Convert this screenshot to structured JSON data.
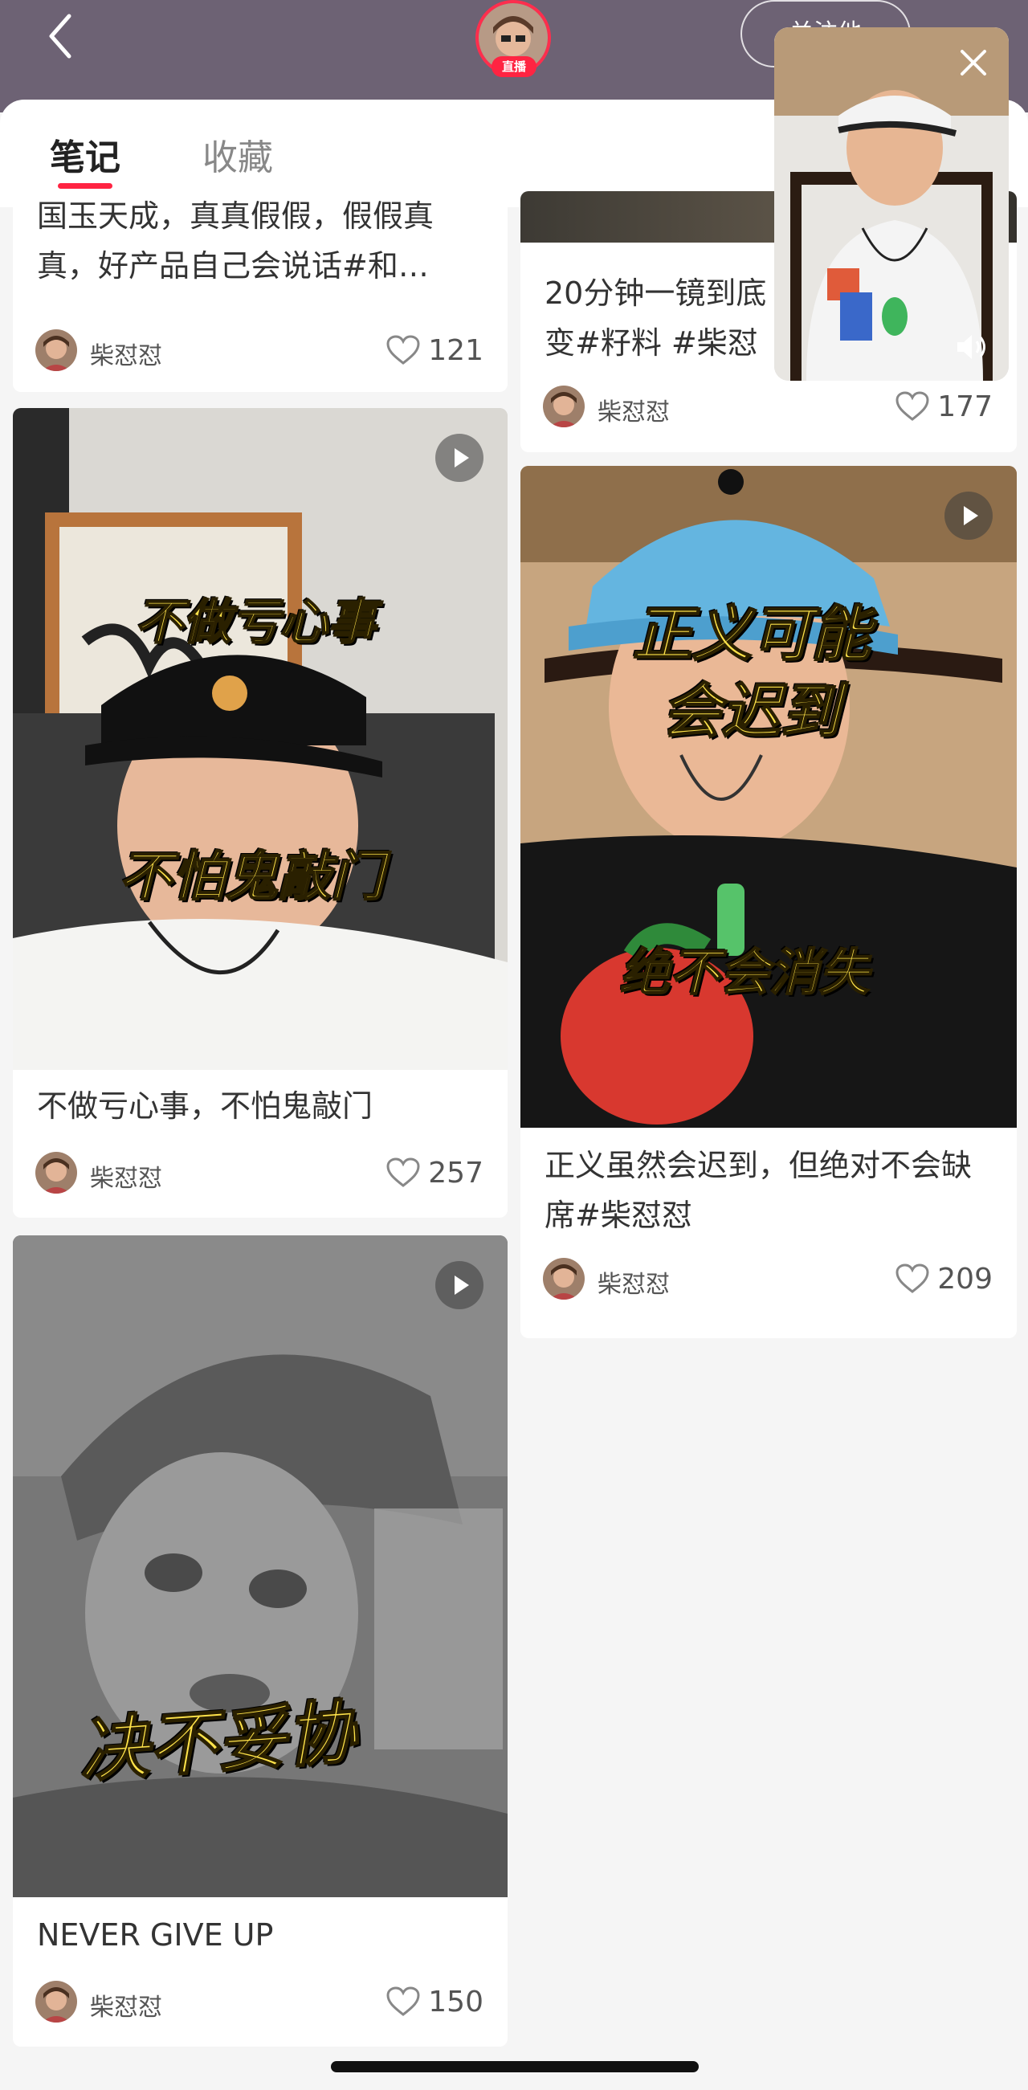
{
  "header": {
    "live_badge": "直播",
    "follow_label": "关注他",
    "background": "#6d6274"
  },
  "tabs": [
    {
      "label": "笔记",
      "active": true
    },
    {
      "label": "收藏",
      "active": false
    }
  ],
  "accent_color": "#ff2442",
  "cards": [
    {
      "title": "国玉天成，真真假假，假假真真，好产品自己会说话#和…",
      "author": "柴怼怼",
      "likes": "121",
      "is_video": false
    },
    {
      "title": "20分钟一镜到底变#籽料 #柴怼怼",
      "author": "柴怼怼",
      "likes": "177",
      "is_video": false
    },
    {
      "title": "不做亏心事，不怕鬼敲门",
      "author": "柴怼怼",
      "likes": "257",
      "is_video": true,
      "caption_top": "不做亏心事",
      "caption_bottom": "不怕鬼敲门"
    },
    {
      "title": "正义虽然会迟到，但绝对不会缺席#柴怼怼",
      "author": "柴怼怼",
      "likes": "209",
      "is_video": true,
      "caption_top_1": "正义可能",
      "caption_top_2": "会迟到",
      "caption_bottom": "绝不会消失"
    },
    {
      "title": "NEVER GIVE UP",
      "author": "柴怼怼",
      "likes": "150",
      "is_video": true,
      "caption_bottom": "决不妥协"
    }
  ],
  "icons": {
    "back": "chevron-left-icon",
    "play": "play-icon",
    "like": "heart-outline-icon",
    "close": "close-icon",
    "volume": "speaker-icon"
  }
}
